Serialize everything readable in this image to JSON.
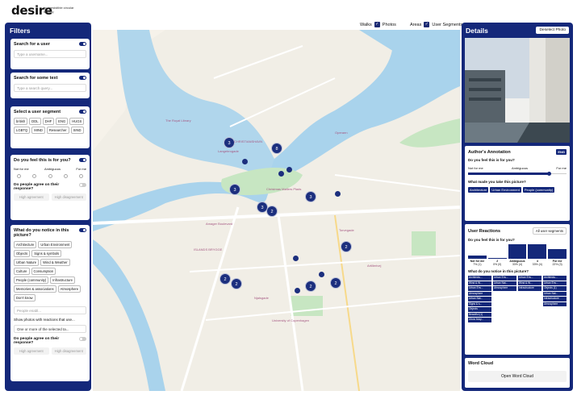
{
  "header": {
    "logo": "desire",
    "tagline": "an irresistible circular society"
  },
  "layers": {
    "walks": "Walks",
    "photos": "Photos",
    "areas": "Areas",
    "segments": "User Segments"
  },
  "filters": {
    "title": "Filters",
    "user": {
      "label": "Search for a user",
      "placeholder": "Type a username..."
    },
    "text": {
      "label": "Search for some text",
      "placeholder": "Type a search query..."
    },
    "segment": {
      "label": "Select a user segment",
      "options": [
        "british",
        "DDL",
        "DHF",
        "ENG",
        "HUGS",
        "LGBTQ",
        "MIND",
        "Researcher",
        "SIND"
      ]
    },
    "feel": {
      "label": "Do you feel this is for you?",
      "left": "Not for me",
      "mid": "Ambiguous",
      "right": "For me",
      "agree": "Do people agree on their response?",
      "high_agree": "High agreement",
      "high_disagree": "High disagreement"
    },
    "notice": {
      "label": "What do you notice in this picture?",
      "options": [
        "Architecture",
        "Urban Environment",
        "Objects",
        "Signs & symbols",
        "Urban Nature",
        "Wind & Weather",
        "Culture",
        "Consumption",
        "People (community)",
        "Infrastructure",
        "Memories & associations",
        "Atmosphere",
        "Don't know"
      ],
      "select_placeholder": "People enabl...",
      "show_label": "Show photos with reactions that use...",
      "show_value": "One or more of the selected ta...",
      "agree": "Do people agree on their response?",
      "high_agree": "High agreement",
      "high_disagree": "High disagreement"
    }
  },
  "map": {
    "clusters": [
      {
        "n": "3"
      },
      {
        "n": "8"
      },
      {
        "n": "3"
      },
      {
        "n": "3"
      },
      {
        "n": "2"
      },
      {
        "n": "3"
      },
      {
        "n": "2"
      },
      {
        "n": "2"
      },
      {
        "n": "2"
      },
      {
        "n": "2"
      },
      {
        "n": "2"
      }
    ],
    "labels": [
      "CHRISTIANSHAVN",
      "ISLANDS BRYGGE",
      "Amager Boulevard",
      "Langebrogade",
      "Christmas Møllers Plads",
      "Njalsgade",
      "Artillerivej",
      "Torvegade",
      "University of Copenhagen",
      "The Royal Library",
      "Operaen"
    ]
  },
  "details": {
    "title": "Details",
    "deselect": "Deselect Photo",
    "annotation": {
      "title": "Author's Annotation",
      "badge": "ENG",
      "q1": "Do you feel this is for you?",
      "left": "Not for me",
      "mid": "Ambiguous",
      "right": "For me",
      "value": 0.82,
      "q2": "What made you take this picture?",
      "tags": [
        "Architecture",
        "Urban Environment",
        "People (community)"
      ]
    },
    "reactions": {
      "title": "User Reactions",
      "select": "All user segments",
      "q1": "Do you feel this is for you?",
      "bars": [
        {
          "l": "Not for me",
          "p": "7% (1)",
          "v": 7
        },
        {
          "l": "2",
          "p": "0% (0)",
          "v": 0
        },
        {
          "l": "Ambiguous",
          "p": "33% (4)",
          "v": 33
        },
        {
          "l": "4",
          "p": "33% (4)",
          "v": 33
        },
        {
          "l": "For me",
          "p": "22% (3)",
          "v": 22
        }
      ],
      "q2": "What do you notice in this picture?",
      "cols": [
        [
          "Architectu...",
          "Wind & W...",
          "Urban Env...",
          "Atmosphere",
          "Urban Nat...",
          "Signs & s...",
          "Objects",
          "Beautiful (1)",
          "Ulcos busy..."
        ],
        [
          "Urban Env...",
          "Urban Nat...",
          "Atmosphere"
        ],
        [
          "Urban Env...",
          "Wind & W...",
          "Infrastructure"
        ],
        [
          "Architectu...",
          "Urban Env...",
          "Objects (1)",
          "Urban Nat...",
          "Infrastructure",
          "Atmosphere"
        ]
      ]
    },
    "wordcloud": {
      "title": "Word Cloud",
      "button": "Open Word Cloud"
    }
  }
}
